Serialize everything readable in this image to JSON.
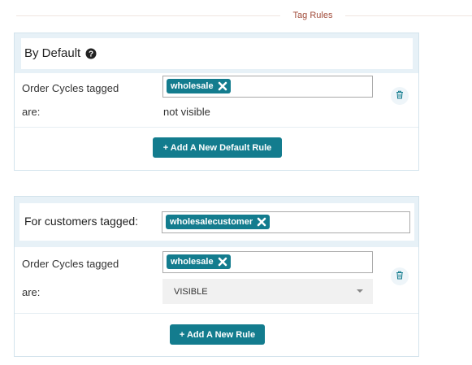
{
  "section": {
    "title": "Tag Rules"
  },
  "default_panel": {
    "title": "By Default",
    "rule": {
      "label": "Order Cycles tagged",
      "are_label": "are:",
      "tag": "wholesale",
      "visibility": "not visible"
    },
    "add_button_label": "+ Add A New Default Rule"
  },
  "customer_panel": {
    "title": "For customers tagged:",
    "customer_tag": "wholesalecustomer",
    "rule": {
      "label": "Order Cycles tagged",
      "are_label": "are:",
      "tag": "wholesale",
      "visibility_selected": "VISIBLE"
    },
    "add_button_label": "+ Add A New Rule"
  },
  "colors": {
    "accent": "#137c8e",
    "header_title": "#a14b3a",
    "panel_border": "#d3e3ec"
  }
}
